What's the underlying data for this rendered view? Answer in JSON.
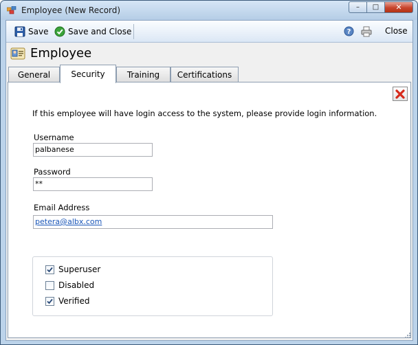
{
  "window": {
    "title": "Employee (New Record)",
    "minimize_glyph": "–",
    "maximize_glyph": "□",
    "close_glyph": "✕"
  },
  "toolbar": {
    "save_label": "Save",
    "save_close_label": "Save and Close",
    "close_label": "Close",
    "icons": [
      "save-icon",
      "save-and-close-icon",
      "help-icon",
      "print-icon"
    ]
  },
  "form": {
    "title": "Employee"
  },
  "tabs": [
    {
      "label": "General",
      "active": false
    },
    {
      "label": "Security",
      "active": true
    },
    {
      "label": "Training",
      "active": false
    },
    {
      "label": "Certifications",
      "active": false
    }
  ],
  "security": {
    "instructions": "If this employee will have login access to the system, please provide login information.",
    "username_label": "Username",
    "username_value": "palbanese",
    "password_label": "Password",
    "password_value": "**",
    "email_label": "Email Address",
    "email_value": "petera@albx.com",
    "checkboxes": [
      {
        "label": "Superuser",
        "checked": true
      },
      {
        "label": "Disabled",
        "checked": false
      },
      {
        "label": "Verified",
        "checked": true
      }
    ]
  },
  "colors": {
    "window_frame": "#bcd3ea",
    "close_button": "#c8452e",
    "link": "#1a56b8",
    "delete_icon": "#d62a1b"
  }
}
